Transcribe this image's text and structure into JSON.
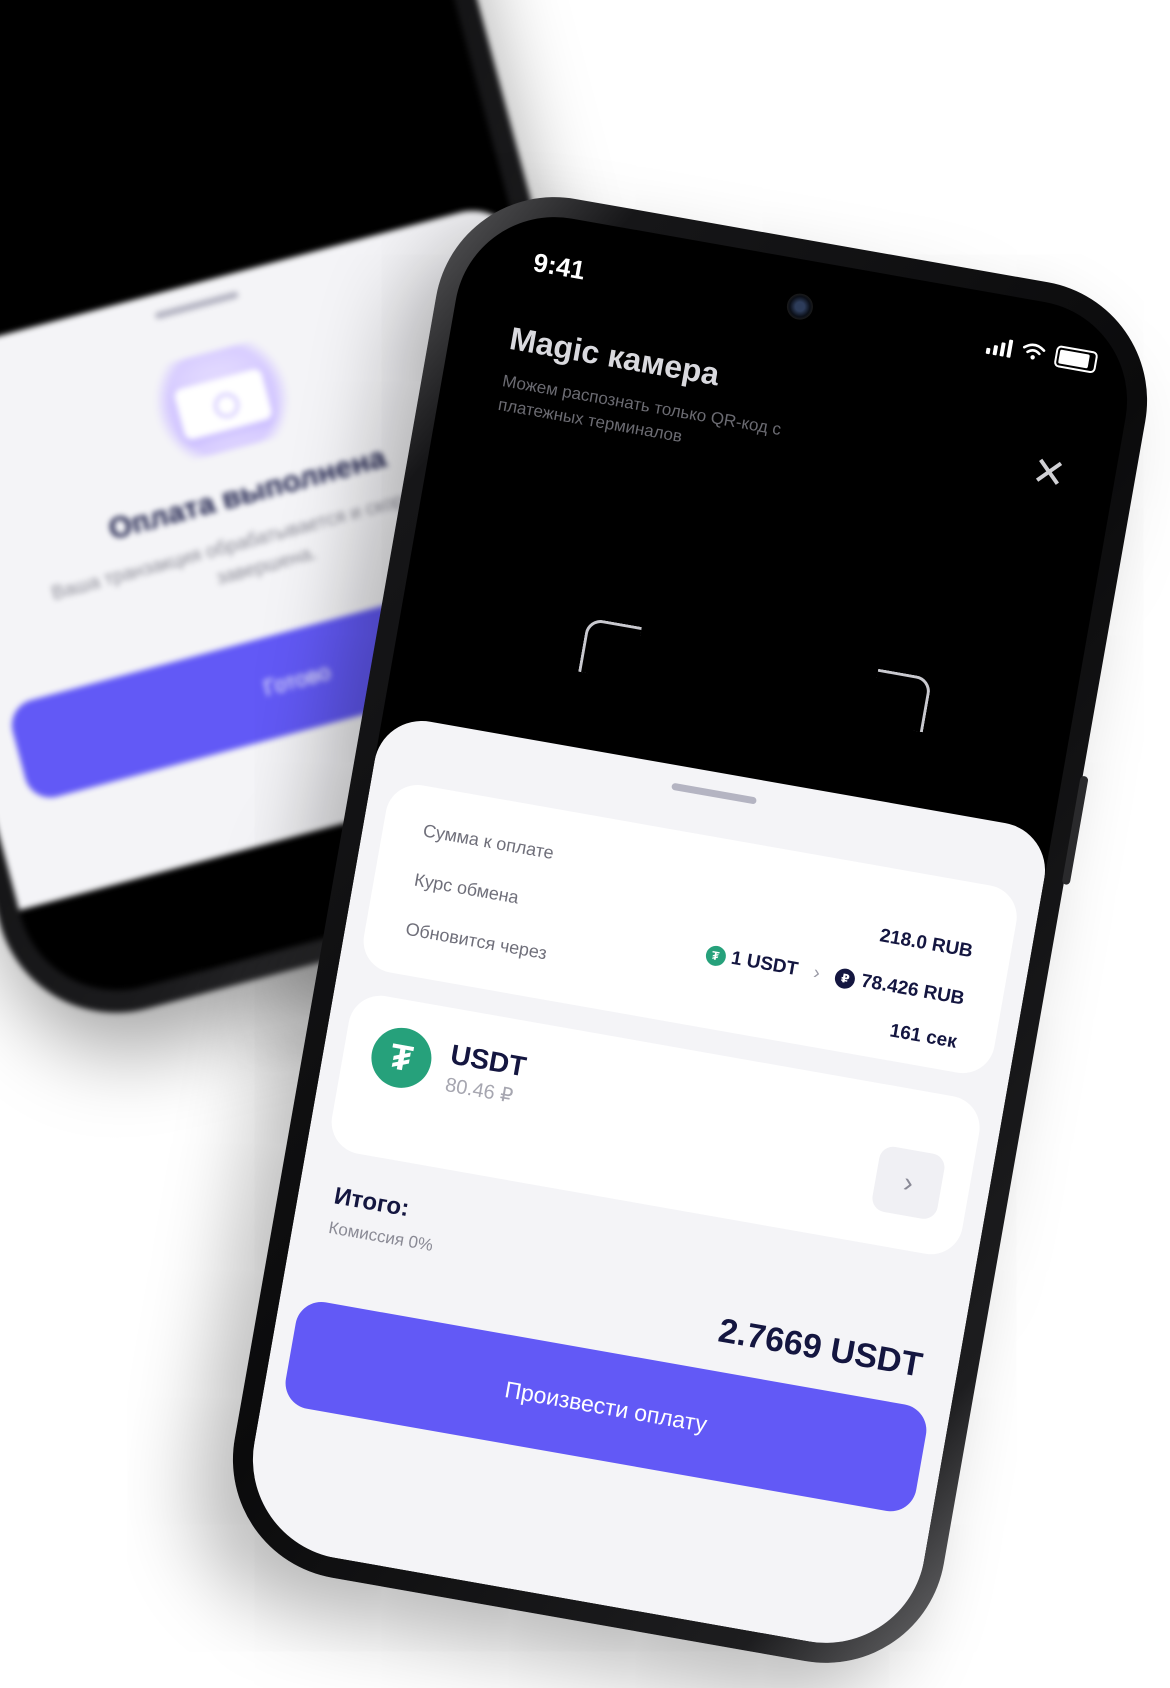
{
  "back_phone": {
    "title": "Оплата выполнена",
    "message": "Ваша транзакция обрабатывается и скоро будет завершена.",
    "done_label": "Готово"
  },
  "status_bar": {
    "time": "9:41"
  },
  "camera": {
    "title": "Magic камера",
    "subtitle": "Можем распознать только QR-код с платежных терминалов",
    "close_symbol": "✕"
  },
  "payment": {
    "amount_label": "Сумма к оплате",
    "amount_value": "218.0 RUB",
    "rate_label": "Курс обмена",
    "rate_from": "1 USDT",
    "rate_to": "78.426 RUB",
    "refresh_label": "Обновится через",
    "refresh_value": "161 сек"
  },
  "asset": {
    "name": "USDT",
    "balance": "80.46 ₽",
    "icon": "tether-icon",
    "icon_glyph": "₮",
    "color": "#26a17b"
  },
  "summary": {
    "total_label": "Итого:",
    "commission": "Комиссия 0%",
    "total_value": "2.7669 USDT"
  },
  "actions": {
    "pay_label": "Произвести оплату"
  },
  "colors": {
    "accent": "#6259f6",
    "tether": "#26a17b",
    "ruble": "#141640"
  }
}
